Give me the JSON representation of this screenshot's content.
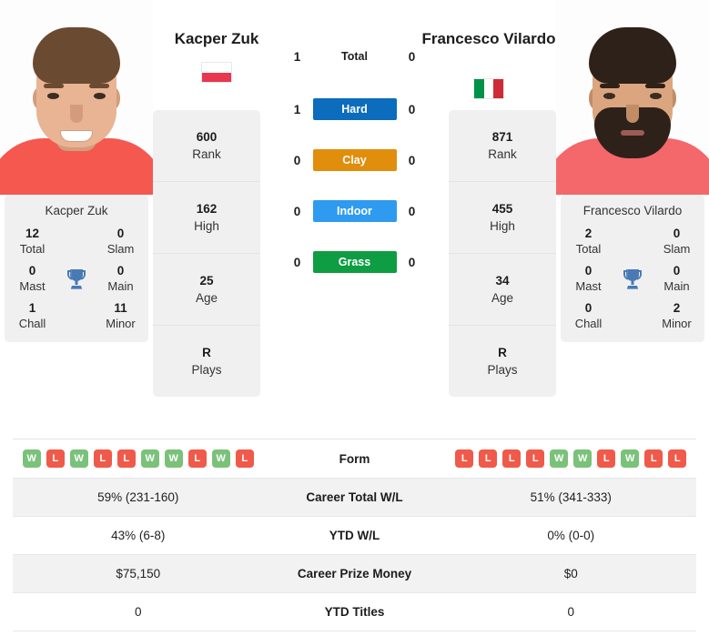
{
  "players": {
    "left": {
      "name": "Kacper Zuk",
      "card_name": "Kacper Zuk",
      "flag_name": "poland-flag",
      "flag_colors": [
        "#ffffff",
        "#e8374f"
      ],
      "titles": {
        "total_value": "12",
        "total_label": "Total",
        "slam_value": "0",
        "slam_label": "Slam",
        "mast_value": "0",
        "mast_label": "Mast",
        "main_value": "0",
        "main_label": "Main",
        "chall_value": "1",
        "chall_label": "Chall",
        "minor_value": "11",
        "minor_label": "Minor"
      },
      "ranks": [
        {
          "value": "600",
          "label": "Rank"
        },
        {
          "value": "162",
          "label": "High"
        },
        {
          "value": "25",
          "label": "Age"
        },
        {
          "value": "R",
          "label": "Plays"
        }
      ],
      "surface_wins": {
        "total": "1",
        "hard": "1",
        "clay": "0",
        "indoor": "0",
        "grass": "0"
      },
      "form": [
        "W",
        "L",
        "W",
        "L",
        "L",
        "W",
        "W",
        "L",
        "W",
        "L"
      ],
      "career_wl": "59% (231-160)",
      "ytd_wl": "43% (6-8)",
      "career_prize": "$75,150",
      "ytd_titles": "0",
      "photo": {
        "skin": "#e8b494",
        "skin_shadow": "#d49c7c",
        "hair": "#6b4a32",
        "shirt": "#f4584f",
        "beard": "transparent"
      }
    },
    "right": {
      "name": "Francesco Vilardo",
      "card_name": "Francesco Vilardo",
      "flag_name": "italy-flag",
      "flag_colors": [
        "#009246",
        "#ffffff",
        "#ce2b37"
      ],
      "titles": {
        "total_value": "2",
        "total_label": "Total",
        "slam_value": "0",
        "slam_label": "Slam",
        "mast_value": "0",
        "mast_label": "Mast",
        "main_value": "0",
        "main_label": "Main",
        "chall_value": "0",
        "chall_label": "Chall",
        "minor_value": "2",
        "minor_label": "Minor"
      },
      "ranks": [
        {
          "value": "871",
          "label": "Rank"
        },
        {
          "value": "455",
          "label": "High"
        },
        {
          "value": "34",
          "label": "Age"
        },
        {
          "value": "R",
          "label": "Plays"
        }
      ],
      "surface_wins": {
        "total": "0",
        "hard": "0",
        "clay": "0",
        "indoor": "0",
        "grass": "0"
      },
      "form": [
        "L",
        "L",
        "L",
        "L",
        "W",
        "W",
        "L",
        "W",
        "L",
        "L"
      ],
      "career_wl": "51% (341-333)",
      "ytd_wl": "0% (0-0)",
      "career_prize": "$0",
      "ytd_titles": "0",
      "photo": {
        "skin": "#dba67f",
        "skin_shadow": "#c08d66",
        "hair": "#2e211a",
        "shirt": "#f4676b",
        "beard": "#2e211a"
      }
    }
  },
  "surfaces": [
    {
      "key": "total",
      "label": "Total",
      "color": "transparent",
      "text_color": "#1c1c1c"
    },
    {
      "key": "hard",
      "label": "Hard",
      "color": "#0c6cbd",
      "text_color": "#ffffff"
    },
    {
      "key": "clay",
      "label": "Clay",
      "color": "#e08e0b",
      "text_color": "#ffffff"
    },
    {
      "key": "indoor",
      "label": "Indoor",
      "color": "#2e9bf0",
      "text_color": "#ffffff"
    },
    {
      "key": "grass",
      "label": "Grass",
      "color": "#0f9d44",
      "text_color": "#ffffff"
    }
  ],
  "table": {
    "form_label": "Form",
    "rows": [
      {
        "label": "Career Total W/L",
        "left": "59% (231-160)",
        "right": "51% (341-333)"
      },
      {
        "label": "YTD W/L",
        "left": "43% (6-8)",
        "right": "0% (0-0)"
      },
      {
        "label": "Career Prize Money",
        "left": "$75,150",
        "right": "$0"
      },
      {
        "label": "YTD Titles",
        "left": "0",
        "right": "0"
      }
    ]
  },
  "colors": {
    "panel_bg": "#f0f0f0",
    "row_shaded": "#f2f2f2",
    "win_badge": "#7ac27a",
    "loss_badge": "#f05a4a",
    "trophy": "#4a7ab5"
  }
}
